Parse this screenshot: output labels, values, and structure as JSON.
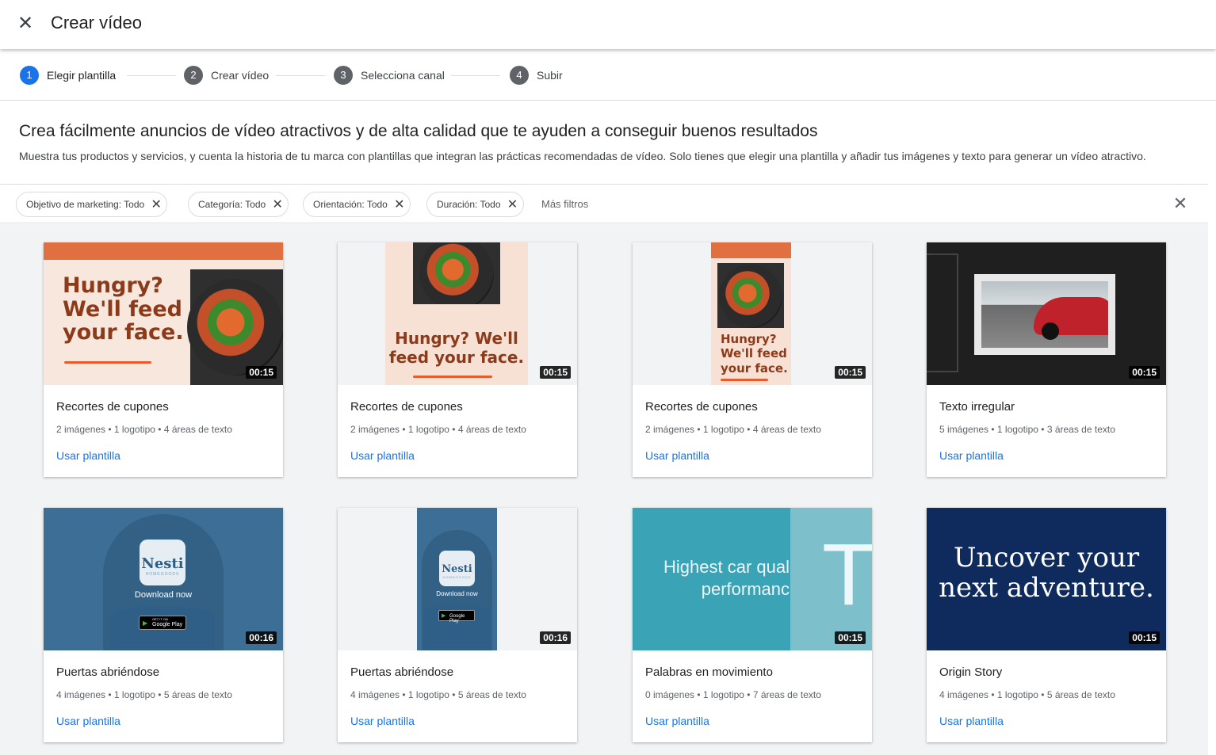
{
  "header": {
    "title": "Crear vídeo",
    "close_icon": "close-icon"
  },
  "steps": [
    {
      "num": "1",
      "label": "Elegir plantilla",
      "active": true
    },
    {
      "num": "2",
      "label": "Crear vídeo",
      "active": false
    },
    {
      "num": "3",
      "label": "Selecciona canal",
      "active": false
    },
    {
      "num": "4",
      "label": "Subir",
      "active": false
    }
  ],
  "intro": {
    "heading": "Crea fácilmente anuncios de vídeo atractivos y de alta calidad que te ayuden a conseguir buenos resultados",
    "body": "Muestra tus productos y servicios, y cuenta la historia de tu marca con plantillas que integran las prácticas recomendadas de vídeo. Solo tienes que elegir una plantilla y añadir tus imágenes y texto para generar un vídeo atractivo."
  },
  "filters": {
    "chips": [
      "Objetivo de marketing: Todo",
      "Categoría: Todo",
      "Orientación: Todo",
      "Duración: Todo"
    ],
    "more": "Más filtros"
  },
  "thumb_text": {
    "food_wide": "Hungry? We'll feed your face.",
    "food_square_1": "Hungry? We'll",
    "food_square_2": "feed your face.",
    "food_tall_1": "Hungry?",
    "food_tall_2": "We'll feed",
    "food_tall_3": "your face.",
    "nesti_logo": "Nesti",
    "nesti_sub": "HOMEGOODS",
    "download": "Download now",
    "gplay_small": "GET IT ON",
    "gplay": "Google Play",
    "car_1": "Highest car qual",
    "car_2": "performanc",
    "car_big": "T",
    "origin_1": "Uncover your",
    "origin_2": "next adventure."
  },
  "cards": [
    {
      "title": "Recortes de cupones",
      "meta": "2 imágenes • 1 logotipo • 4 áreas de texto",
      "duration": "00:15",
      "action": "Usar plantilla"
    },
    {
      "title": "Recortes de cupones",
      "meta": "2 imágenes • 1 logotipo • 4 áreas de texto",
      "duration": "00:15",
      "action": "Usar plantilla"
    },
    {
      "title": "Recortes de cupones",
      "meta": "2 imágenes • 1 logotipo • 4 áreas de texto",
      "duration": "00:15",
      "action": "Usar plantilla"
    },
    {
      "title": "Texto irregular",
      "meta": "5 imágenes • 1 logotipo • 3 áreas de texto",
      "duration": "00:15",
      "action": "Usar plantilla"
    },
    {
      "title": "Puertas abriéndose",
      "meta": "4 imágenes • 1 logotipo • 5 áreas de texto",
      "duration": "00:16",
      "action": "Usar plantilla"
    },
    {
      "title": "Puertas abriéndose",
      "meta": "4 imágenes • 1 logotipo • 5 áreas de texto",
      "duration": "00:16",
      "action": "Usar plantilla"
    },
    {
      "title": "Palabras en movimiento",
      "meta": "0 imágenes • 1 logotipo • 7 áreas de texto",
      "duration": "00:15",
      "action": "Usar plantilla"
    },
    {
      "title": "Origin Story",
      "meta": "4 imágenes • 1 logotipo • 5 áreas de texto",
      "duration": "00:15",
      "action": "Usar plantilla"
    }
  ],
  "colors": {
    "accent": "#1a73e8",
    "food_orange": "#e07040",
    "nesti_blue": "#3d6f96",
    "origin_navy": "#0f2a5c",
    "teal": "#3aa3b5"
  }
}
